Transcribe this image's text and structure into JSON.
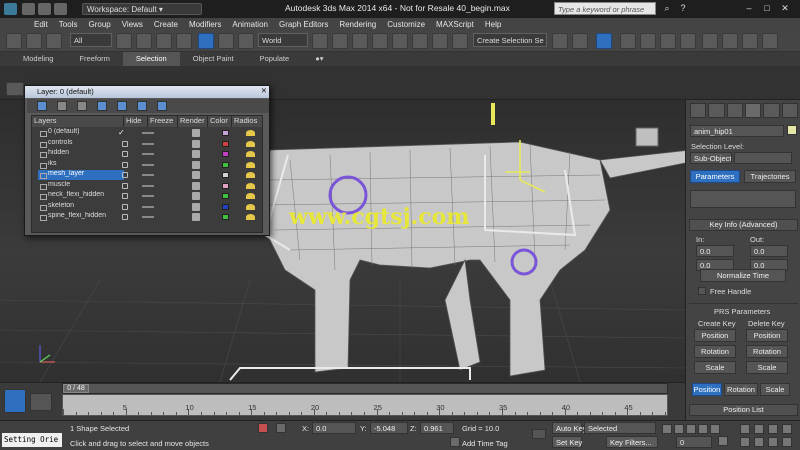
{
  "titlebar": {
    "app_title": "Autodesk 3ds Max  2014 x64   -  Not for Resale    40_begin.max",
    "workspace_label": "Workspace: Default",
    "search_placeholder": "Type a keyword or phrase"
  },
  "menu": [
    "Edit",
    "Tools",
    "Group",
    "Views",
    "Create",
    "Modifiers",
    "Animation",
    "Graph Editors",
    "Rendering",
    "Customize",
    "MAXScript",
    "Help"
  ],
  "toolbar": {
    "selection_filter": "All",
    "ref_coord": "World",
    "named_selection": "Create Selection Se"
  },
  "ribbon_tabs": [
    "Modeling",
    "Freeform",
    "Selection",
    "Object Paint",
    "Populate"
  ],
  "ribbon_active": "Selection",
  "layer_dialog": {
    "title": "Layer: 0 (default)",
    "columns": [
      "Layers",
      "Hide",
      "Freeze",
      "Render",
      "Color",
      "Radios"
    ],
    "rows": [
      {
        "name": "0 (default)",
        "checked": true,
        "color": "#c8a0d8",
        "selected": false
      },
      {
        "name": "controls",
        "checked": false,
        "color": "#d04040",
        "selected": false
      },
      {
        "name": "hidden",
        "checked": false,
        "color": "#c040c0",
        "selected": false
      },
      {
        "name": "iks",
        "checked": false,
        "color": "#40c040",
        "selected": false
      },
      {
        "name": "mesh_layer",
        "checked": false,
        "color": "#d0d0d0",
        "selected": true
      },
      {
        "name": "muscle",
        "checked": false,
        "color": "#e0a0c0",
        "selected": false
      },
      {
        "name": "neck_flexi_hidden",
        "checked": false,
        "color": "#40c040",
        "selected": false
      },
      {
        "name": "skeleton",
        "checked": false,
        "color": "#2040c0",
        "selected": false
      },
      {
        "name": "spine_flexi_hidden",
        "checked": false,
        "color": "#40c040",
        "selected": false
      }
    ]
  },
  "viewport": {
    "watermark": "www.cgtsj.com"
  },
  "command_panel": {
    "object_name": "anim_hip01",
    "selection_level_label": "Selection Level:",
    "sub_object": "Sub-Object",
    "tab_parameters": "Parameters",
    "tab_trajectories": "Trajectories",
    "key_info_rollout": "Key Info (Advanced)",
    "in_label": "In:",
    "out_label": "Out:",
    "in_value_1": "0.0",
    "in_value_2": "0.0",
    "out_value_1": "0.0",
    "out_value_2": "0.0",
    "normalize_time": "Normalize Time",
    "free_handle": "Free Handle",
    "prs_rollout": "PRS Parameters",
    "create_key": "Create Key",
    "delete_key": "Delete Key",
    "position": "Position",
    "rotation": "Rotation",
    "scale": "Scale",
    "position_list": "Position List"
  },
  "timeline": {
    "frame_readout": "0 / 48",
    "ticks": [
      0,
      5,
      10,
      15,
      20,
      25,
      30,
      35,
      40,
      45
    ]
  },
  "status": {
    "script_listener": "Setting Orie",
    "selected_text": "1 Shape Selected",
    "prompt": "Click and drag to select and move objects",
    "x_label": "X:",
    "x_value": "0.0",
    "y_label": "Y:",
    "y_value": "-5.048",
    "z_label": "Z:",
    "z_value": "0.961",
    "grid": "Grid = 10.0",
    "add_time_tag": "Add Time Tag",
    "auto_key": "Auto Key",
    "set_key": "Set Key",
    "selected_dropdown": "Selected",
    "key_filters": "Key Filters...",
    "frame": "0"
  }
}
